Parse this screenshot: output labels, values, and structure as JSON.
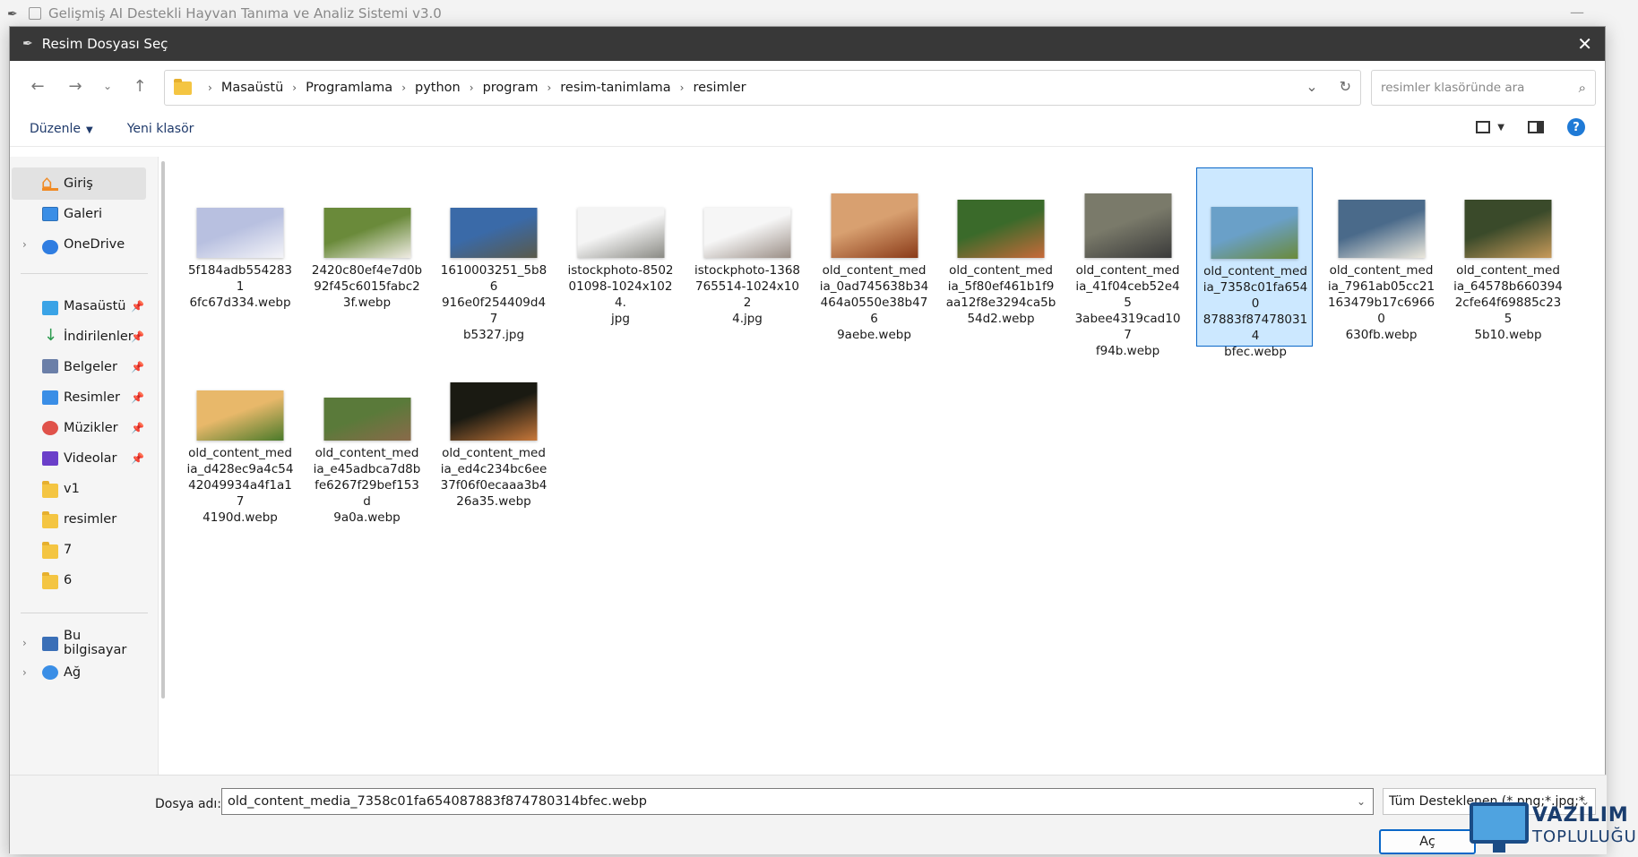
{
  "background_app": {
    "title": "Gelişmiş AI Destekli Hayvan Tanıma ve Analiz Sistemi v3.0"
  },
  "dialog": {
    "title": "Resim Dosyası Seç",
    "breadcrumb": [
      "Masaüstü",
      "Programlama",
      "python",
      "program",
      "resim-tanimlama",
      "resimler"
    ],
    "search_placeholder": "resimler klasöründe ara",
    "toolbar": {
      "organize_label": "Düzenle",
      "new_folder_label": "Yeni klasör",
      "help_label": "?"
    },
    "sidebar": {
      "home": "Giriş",
      "gallery": "Galeri",
      "onedrive": "OneDrive",
      "quick_access": [
        "Masaüstü",
        "İndirilenler",
        "Belgeler",
        "Resimler",
        "Müzikler",
        "Videolar"
      ],
      "folders": [
        "v1",
        "resimler",
        "7",
        "6"
      ],
      "this_pc": "Bu bilgisayar",
      "network": "Ağ"
    },
    "files": [
      {
        "name": "5f184adb55428316fc67d334.webp",
        "lines": [
          "5f184adb5542831",
          "6fc67d334.webp"
        ],
        "thumb_colors": [
          "#b8c0e0",
          "#f4f4f8"
        ]
      },
      {
        "name": "2420c80ef4e7d0b92f45c6015fabc23f.webp",
        "lines": [
          "2420c80ef4e7d0b",
          "92f45c6015fabc2",
          "3f.webp"
        ],
        "thumb_colors": [
          "#6a8a3a",
          "#f0ece4"
        ]
      },
      {
        "name": "1610003251_5b86916e0f254409d47b5327.jpg",
        "lines": [
          "1610003251_5b86",
          "916e0f254409d47",
          "b5327.jpg"
        ],
        "thumb_colors": [
          "#3a6aa8",
          "#5a5a4a"
        ]
      },
      {
        "name": "istockphoto-850201098-1024x1024.jpg",
        "lines": [
          "istockphoto-8502",
          "01098-1024x1024.",
          "jpg"
        ],
        "thumb_colors": [
          "#f4f4f4",
          "#8a8a84"
        ]
      },
      {
        "name": "istockphoto-1368765514-1024x1024.jpg",
        "lines": [
          "istockphoto-1368",
          "765514-1024x102",
          "4.jpg"
        ],
        "thumb_colors": [
          "#f6f6f6",
          "#9a8e86"
        ]
      },
      {
        "name": "old_content_media_0ad745638b34464a0550e38b4769aebe.webp",
        "lines": [
          "old_content_med",
          "ia_0ad745638b34",
          "464a0550e38b476",
          "9aebe.webp"
        ],
        "thumb_colors": [
          "#d8a070",
          "#8a3a18"
        ]
      },
      {
        "name": "old_content_media_5f80ef461b1f9aa12f8e3294ca5b54d2.webp",
        "lines": [
          "old_content_med",
          "ia_5f80ef461b1f9",
          "aa12f8e3294ca5b",
          "54d2.webp"
        ],
        "thumb_colors": [
          "#3a6a2a",
          "#c86a3a"
        ]
      },
      {
        "name": "old_content_media_41f04ceb52e453abee4319cad107f94b.webp",
        "lines": [
          "old_content_med",
          "ia_41f04ceb52e45",
          "3abee4319cad107",
          "f94b.webp"
        ],
        "thumb_colors": [
          "#7a7a6a",
          "#3a3a3a"
        ]
      },
      {
        "name": "old_content_media_7358c01fa654087883f874780314bfec.webp",
        "lines": [
          "old_content_med",
          "ia_7358c01fa6540",
          "87883f874780314",
          "bfec.webp"
        ],
        "thumb_colors": [
          "#6aa0c8",
          "#6a8a3a"
        ]
      },
      {
        "name": "old_content_media_7961ab05cc21163479b17c69660630fb.webp",
        "lines": [
          "old_content_med",
          "ia_7961ab05cc21",
          "163479b17c69660",
          "630fb.webp"
        ],
        "thumb_colors": [
          "#4a6a8a",
          "#ece8dc"
        ]
      },
      {
        "name": "old_content_media_64578b6603942cfe64f69885c2355b10.webp",
        "lines": [
          "old_content_med",
          "ia_64578b660394",
          "2cfe64f69885c235",
          "5b10.webp"
        ],
        "thumb_colors": [
          "#3a4a2a",
          "#c89a5a"
        ]
      },
      {
        "name": "old_content_media_d428ec9a4c5442049934a4f1a174190d.webp",
        "lines": [
          "old_content_med",
          "ia_d428ec9a4c54",
          "42049934a4f1a17",
          "4190d.webp"
        ],
        "thumb_colors": [
          "#e8b86a",
          "#4a7a2a"
        ]
      },
      {
        "name": "old_content_media_e45adbca7d8bfe6267f29bef153d9a0a.webp",
        "lines": [
          "old_content_med",
          "ia_e45adbca7d8b",
          "fe6267f29bef153d",
          "9a0a.webp"
        ],
        "thumb_colors": [
          "#5a7a3a",
          "#8a6a4a"
        ]
      },
      {
        "name": "old_content_media_ed4c234bc6ee37f06f0ecaaa3b426a35.webp",
        "lines": [
          "old_content_med",
          "ia_ed4c234bc6ee",
          "37f06f0ecaaa3b4",
          "26a35.webp"
        ],
        "thumb_colors": [
          "#1a1a12",
          "#c8783a"
        ]
      }
    ],
    "selected_index": 8,
    "filename_label": "Dosya adı:",
    "filename_value": "old_content_media_7358c01fa654087883f874780314bfec.webp",
    "filter_value": "Tüm Desteklenen (*.png;*.jpg;*",
    "open_button": "Aç"
  },
  "watermark": {
    "line1": "VAZILIM",
    "line2": "TOPLULUĞU"
  },
  "colors": {
    "accent": "#0a67c8",
    "selection": "#cce8ff",
    "titlebar": "#383838"
  }
}
